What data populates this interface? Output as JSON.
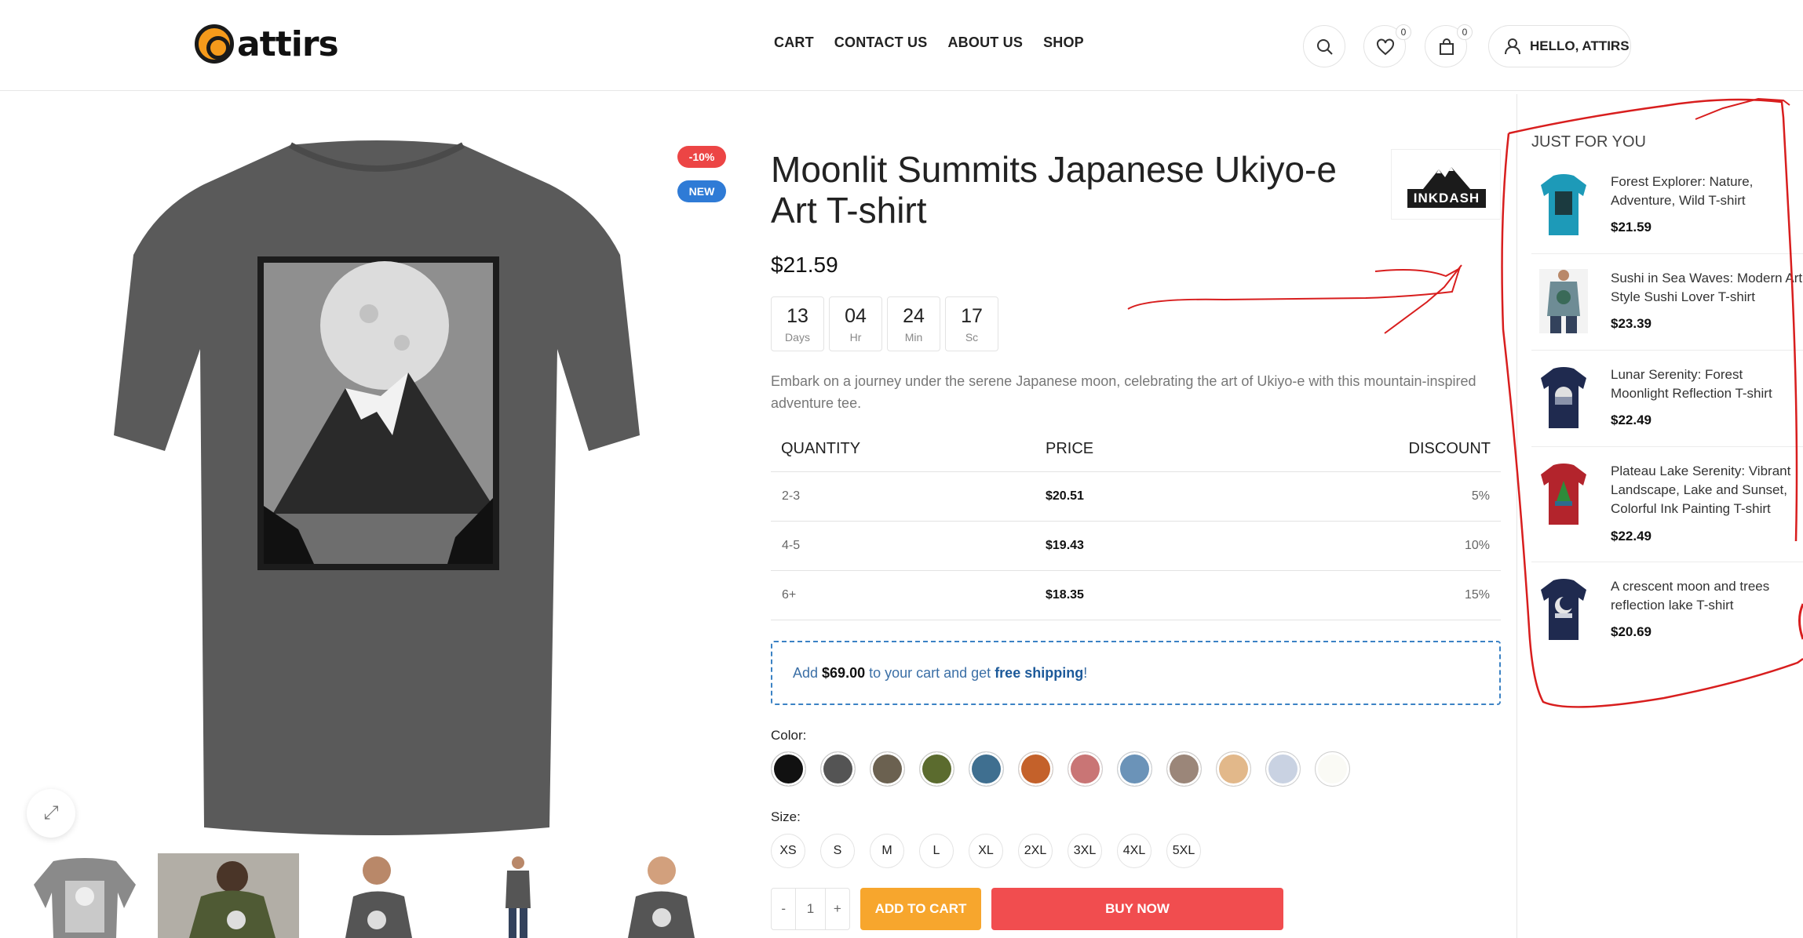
{
  "header": {
    "logo_text": "attirs",
    "nav": [
      "CART",
      "CONTACT US",
      "ABOUT US",
      "SHOP"
    ],
    "wishlist_count": "0",
    "cart_count": "0",
    "account_label": "HELLO, ATTIRS"
  },
  "gallery": {
    "badge_sale": "-10%",
    "badge_new": "NEW"
  },
  "product": {
    "title": "Moonlit Summits Japanese Ukiyo-e Art T-shirt",
    "brand": "INKDASH",
    "price": "$21.59",
    "countdown": [
      {
        "value": "13",
        "label": "Days"
      },
      {
        "value": "04",
        "label": "Hr"
      },
      {
        "value": "24",
        "label": "Min"
      },
      {
        "value": "17",
        "label": "Sc"
      }
    ],
    "description": "Embark on a journey under the serene Japanese moon, celebrating the art of Ukiyo-e with this mountain-inspired adventure tee.",
    "discount_table": {
      "headers": [
        "QUANTITY",
        "PRICE",
        "DISCOUNT"
      ],
      "rows": [
        {
          "qty": "2-3",
          "price": "$20.51",
          "discount": "5%"
        },
        {
          "qty": "4-5",
          "price": "$19.43",
          "discount": "10%"
        },
        {
          "qty": "6+",
          "price": "$18.35",
          "discount": "15%"
        }
      ]
    },
    "shipping": {
      "pre": "Add ",
      "amount": "$69.00",
      "mid": " to your cart and get ",
      "free": "free shipping",
      "post": "!"
    },
    "color_label": "Color:",
    "colors": [
      "#111111",
      "#545454",
      "#6b6150",
      "#5b6b2e",
      "#3f6f90",
      "#c4612a",
      "#c97575",
      "#6b93b8",
      "#9b8679",
      "#e2b88a",
      "#c9d2e2",
      "#fafaf5"
    ],
    "size_label": "Size:",
    "sizes": [
      "XS",
      "S",
      "M",
      "L",
      "XL",
      "2XL",
      "3XL",
      "4XL",
      "5XL"
    ],
    "qty_minus": "-",
    "qty_value": "1",
    "qty_plus": "+",
    "add_to_cart": "ADD TO CART",
    "buy_now": "BUY NOW"
  },
  "sidebar": {
    "title": "JUST FOR YOU",
    "items": [
      {
        "name": "Forest Explorer: Nature, Adventure, Wild T-shirt",
        "price": "$21.59",
        "color": "#1d9ab8"
      },
      {
        "name": "Sushi in Sea Waves: Modern Art Style Sushi Lover T-shirt",
        "price": "$23.39",
        "color": "#6e8c95"
      },
      {
        "name": "Lunar Serenity: Forest Moonlight Reflection T-shirt",
        "price": "$22.49",
        "color": "#1f2a4f"
      },
      {
        "name": "Plateau Lake Serenity: Vibrant Landscape, Lake and Sunset, Colorful Ink Painting T-shirt",
        "price": "$22.49",
        "color": "#b3242c"
      },
      {
        "name": "A crescent moon and trees reflection lake T-shirt",
        "price": "$20.69",
        "color": "#1f2a4f"
      }
    ]
  },
  "colors": {
    "accent_orange": "#f7a62d",
    "accent_red": "#f14d4f",
    "annotation": "#d81e1e"
  }
}
